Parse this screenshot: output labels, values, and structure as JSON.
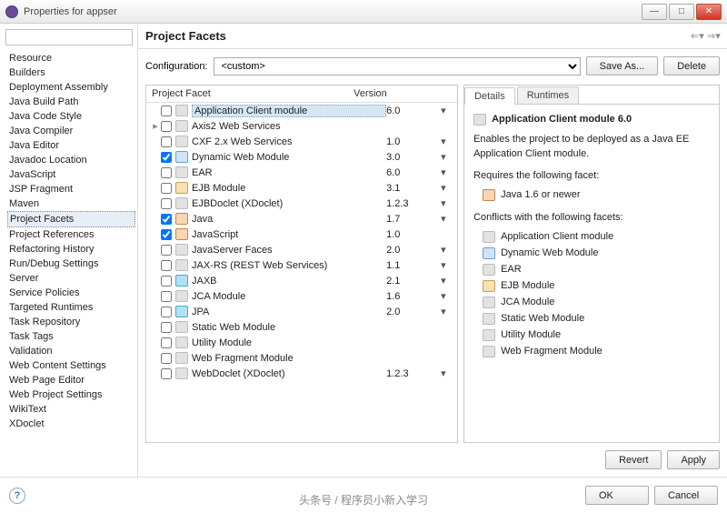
{
  "window": {
    "title": "Properties for appser"
  },
  "nav": {
    "items": [
      "Resource",
      "Builders",
      "Deployment Assembly",
      "Java Build Path",
      "Java Code Style",
      "Java Compiler",
      "Java Editor",
      "Javadoc Location",
      "JavaScript",
      "JSP Fragment",
      "Maven",
      "Project Facets",
      "Project References",
      "Refactoring History",
      "Run/Debug Settings",
      "Server",
      "Service Policies",
      "Targeted Runtimes",
      "Task Repository",
      "Task Tags",
      "Validation",
      "Web Content Settings",
      "Web Page Editor",
      "Web Project Settings",
      "WikiText",
      "XDoclet"
    ],
    "selected": "Project Facets"
  },
  "header": {
    "title": "Project Facets"
  },
  "config": {
    "label": "Configuration:",
    "value": "<custom>",
    "save": "Save As...",
    "delete": "Delete"
  },
  "table": {
    "col1": "Project Facet",
    "col2": "Version",
    "rows": [
      {
        "label": "Application Client module",
        "ver": "6.0",
        "checked": false,
        "icon": "",
        "sel": true,
        "dd": true
      },
      {
        "label": "Axis2 Web Services",
        "ver": "",
        "checked": false,
        "icon": "",
        "exp": "▸",
        "dd": false
      },
      {
        "label": "CXF 2.x Web Services",
        "ver": "1.0",
        "checked": false,
        "icon": "",
        "dd": true
      },
      {
        "label": "Dynamic Web Module",
        "ver": "3.0",
        "checked": true,
        "icon": "web",
        "dd": true
      },
      {
        "label": "EAR",
        "ver": "6.0",
        "checked": false,
        "icon": "",
        "dd": true
      },
      {
        "label": "EJB Module",
        "ver": "3.1",
        "checked": false,
        "icon": "ejb",
        "dd": true
      },
      {
        "label": "EJBDoclet (XDoclet)",
        "ver": "1.2.3",
        "checked": false,
        "icon": "",
        "dd": true
      },
      {
        "label": "Java",
        "ver": "1.7",
        "checked": true,
        "icon": "java",
        "dd": true
      },
      {
        "label": "JavaScript",
        "ver": "1.0",
        "checked": true,
        "icon": "java",
        "dd": false
      },
      {
        "label": "JavaServer Faces",
        "ver": "2.0",
        "checked": false,
        "icon": "",
        "dd": true
      },
      {
        "label": "JAX-RS (REST Web Services)",
        "ver": "1.1",
        "checked": false,
        "icon": "",
        "dd": true
      },
      {
        "label": "JAXB",
        "ver": "2.1",
        "checked": false,
        "icon": "jpa",
        "dd": true
      },
      {
        "label": "JCA Module",
        "ver": "1.6",
        "checked": false,
        "icon": "",
        "dd": true
      },
      {
        "label": "JPA",
        "ver": "2.0",
        "checked": false,
        "icon": "jpa",
        "dd": true
      },
      {
        "label": "Static Web Module",
        "ver": "",
        "checked": false,
        "icon": "",
        "dd": false
      },
      {
        "label": "Utility Module",
        "ver": "",
        "checked": false,
        "icon": "",
        "dd": false
      },
      {
        "label": "Web Fragment Module",
        "ver": "",
        "checked": false,
        "icon": "",
        "dd": false
      },
      {
        "label": "WebDoclet (XDoclet)",
        "ver": "1.2.3",
        "checked": false,
        "icon": "",
        "dd": true
      }
    ]
  },
  "details": {
    "tabs": [
      "Details",
      "Runtimes"
    ],
    "active": 0,
    "title": "Application Client module 6.0",
    "desc": "Enables the project to be deployed as a Java EE Application Client module.",
    "reqLabel": "Requires the following facet:",
    "req": [
      {
        "label": "Java 1.6 or newer",
        "icon": "java"
      }
    ],
    "confLabel": "Conflicts with the following facets:",
    "conf": [
      {
        "label": "Application Client module",
        "icon": ""
      },
      {
        "label": "Dynamic Web Module",
        "icon": "web"
      },
      {
        "label": "EAR",
        "icon": ""
      },
      {
        "label": "EJB Module",
        "icon": "ejb"
      },
      {
        "label": "JCA Module",
        "icon": ""
      },
      {
        "label": "Static Web Module",
        "icon": ""
      },
      {
        "label": "Utility Module",
        "icon": ""
      },
      {
        "label": "Web Fragment Module",
        "icon": ""
      }
    ]
  },
  "buttons": {
    "revert": "Revert",
    "apply": "Apply",
    "ok": "OK",
    "cancel": "Cancel"
  },
  "watermark": "头条号 / 程序员小新入学习"
}
